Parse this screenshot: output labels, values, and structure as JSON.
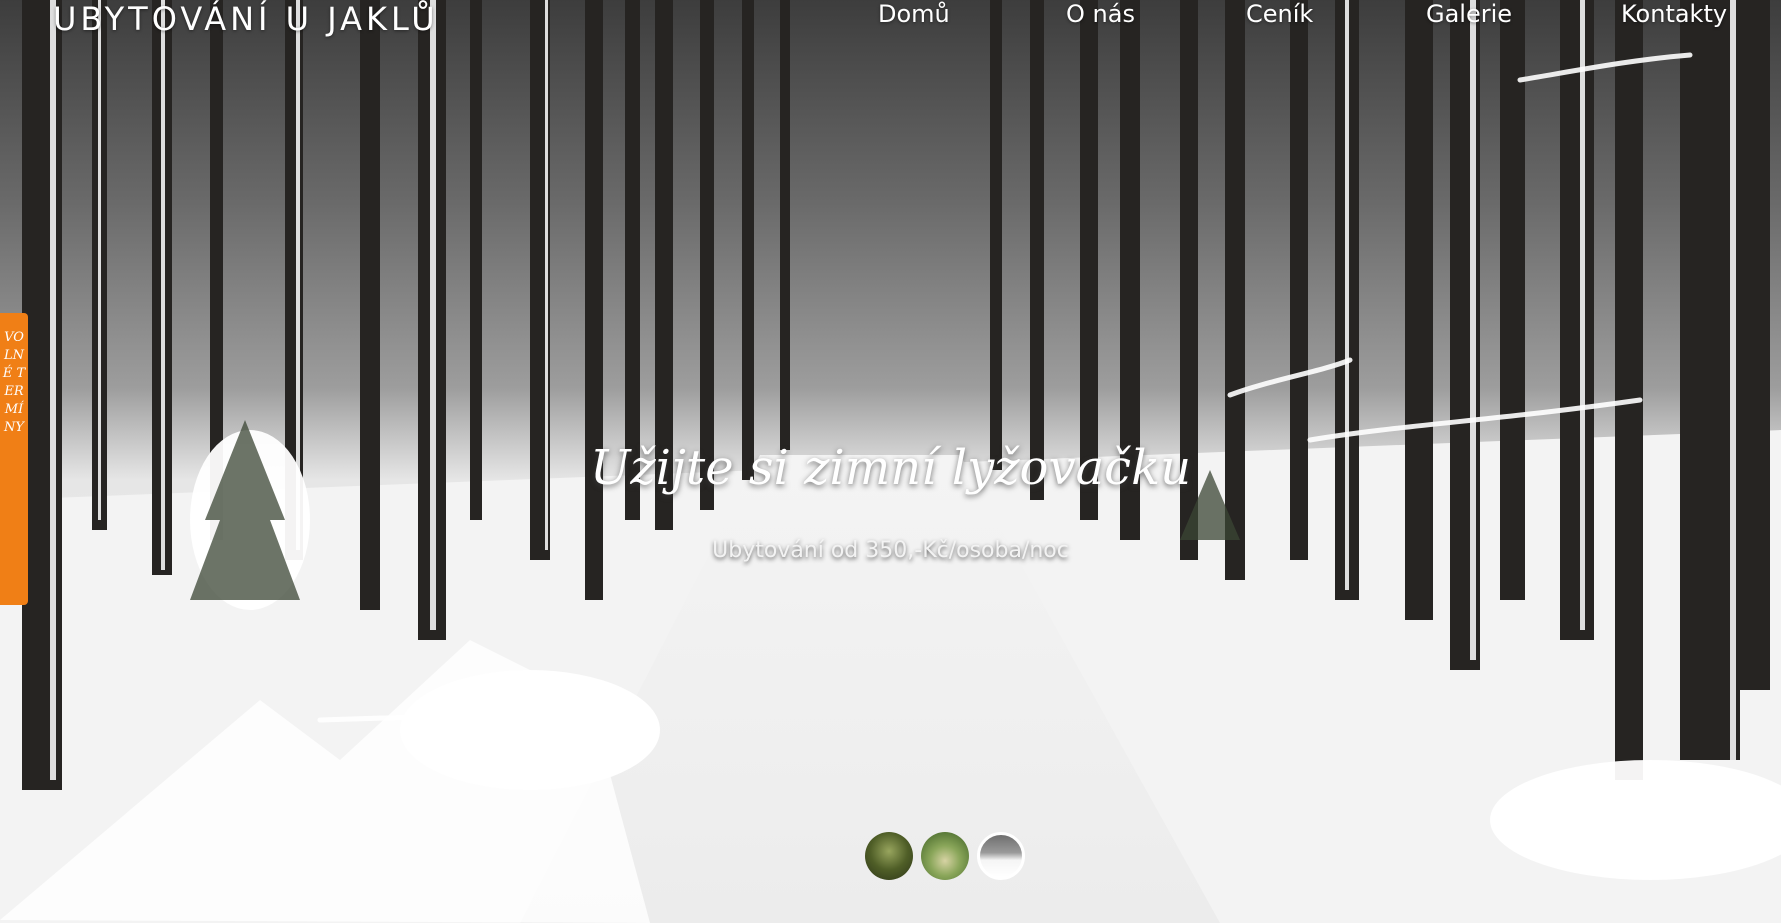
{
  "header": {
    "site_title": "UBYTOVÁNÍ U JAKLŮ"
  },
  "nav": {
    "items": [
      {
        "label": "Domů"
      },
      {
        "label": "O nás"
      },
      {
        "label": "Ceník"
      },
      {
        "label": "Galerie"
      },
      {
        "label": "Kontakty"
      }
    ]
  },
  "side_tab": {
    "label": "VOLNÉ TERMÍNY",
    "color": "#f07f16"
  },
  "hero": {
    "headline": "Užijte si zimní lyžovačku",
    "subheadline": "Ubytování od 350,-Kč/osoba/noc"
  },
  "slider": {
    "active_index": 3,
    "thumbnails": [
      {
        "icon": "forest-thumbnail"
      },
      {
        "icon": "meadow-thumbnail"
      },
      {
        "icon": "winter-forest-thumbnail"
      }
    ]
  }
}
